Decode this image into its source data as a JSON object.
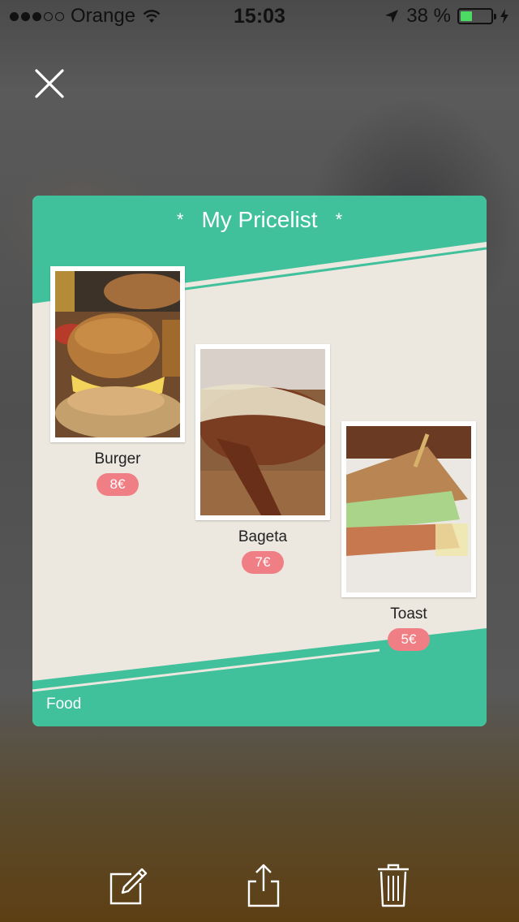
{
  "status_bar": {
    "carrier": "Orange",
    "time": "15:03",
    "battery": "38 %",
    "battery_level": 0.38,
    "signal_bars": 3,
    "signal_max": 5
  },
  "pricelist": {
    "title": "My Pricelist",
    "title_decoration": "*",
    "category": "Food",
    "items": [
      {
        "name": "Burger",
        "price": "8€"
      },
      {
        "name": "Bageta",
        "price": "7€"
      },
      {
        "name": "Toast",
        "price": "5€"
      }
    ]
  },
  "toolbar": {
    "icons": [
      "close-icon",
      "edit-icon",
      "share-icon",
      "trash-icon"
    ]
  },
  "colors": {
    "accent": "#40c19c",
    "card_background": "#ece8df",
    "price_badge": "#f07f85",
    "battery_fill": "#4cd964"
  }
}
